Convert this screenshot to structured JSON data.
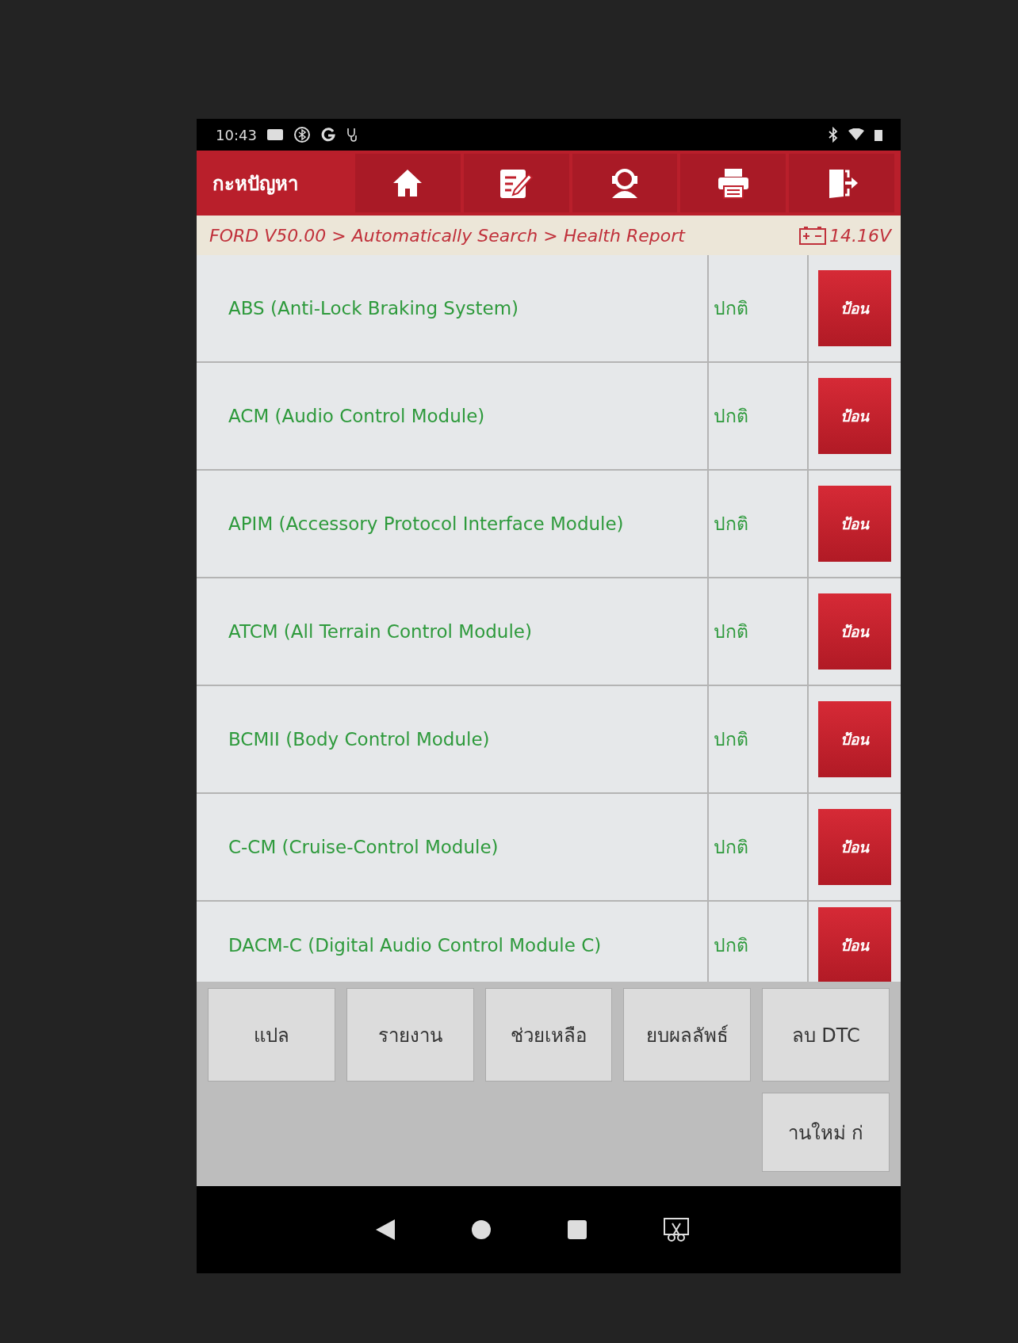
{
  "status_bar": {
    "time": "10:43"
  },
  "header": {
    "title": "กะหปัญหา"
  },
  "breadcrumb": {
    "path": "FORD V50.00 > Automatically Search > Health Report",
    "voltage": "14.16V"
  },
  "modules": [
    {
      "name": "ABS (Anti-Lock Braking System)",
      "status": "ปกติ",
      "action": "ป้อน"
    },
    {
      "name": "ACM (Audio Control Module)",
      "status": "ปกติ",
      "action": "ป้อน"
    },
    {
      "name": "APIM (Accessory Protocol Interface Module)",
      "status": "ปกติ",
      "action": "ป้อน"
    },
    {
      "name": "ATCM (All Terrain Control Module)",
      "status": "ปกติ",
      "action": "ป้อน"
    },
    {
      "name": "BCMII (Body Control Module)",
      "status": "ปกติ",
      "action": "ป้อน"
    },
    {
      "name": "C-CM (Cruise-Control Module)",
      "status": "ปกติ",
      "action": "ป้อน"
    },
    {
      "name": "DACM-C (Digital Audio Control Module C)",
      "status": "ปกติ",
      "action": "ป้อน"
    }
  ],
  "bottom_buttons": [
    "แปล",
    "รายงาน",
    "ช่วยเหลือ",
    "ยบผลลัพธ์",
    "ลบ DTC",
    "านใหม่   ก่"
  ]
}
